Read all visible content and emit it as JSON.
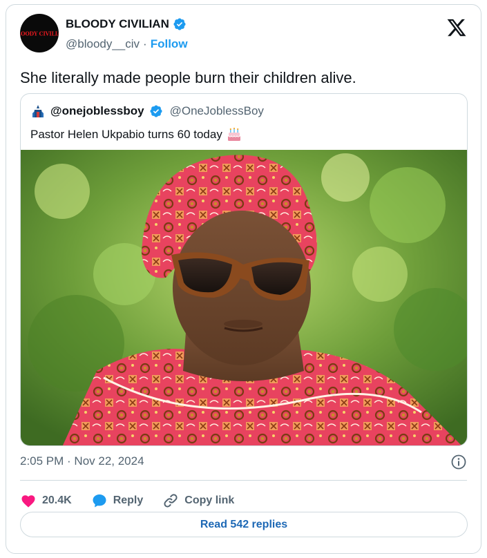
{
  "author": {
    "name": "BLOODY CIVILIAN",
    "handle": "@bloody__civ",
    "separator": "·",
    "follow_label": "Follow",
    "avatar_text": "BLOODY CIVILIAN"
  },
  "tweet": {
    "text": "She literally made people burn their children alive."
  },
  "quoted": {
    "name": "@onejoblessboy",
    "handle": "@OneJoblessBoy",
    "text": "Pastor Helen Ukpabio turns 60 today"
  },
  "meta": {
    "timestamp": "2:05 PM · Nov 22, 2024"
  },
  "actions": {
    "likes": "20.4K",
    "reply_label": "Reply",
    "copy_link_label": "Copy link"
  },
  "read_replies_label": "Read 542 replies",
  "colors": {
    "accent": "#1d9bf0",
    "like": "#f91880",
    "text": "#0f1419",
    "muted": "#536471",
    "border": "#cfd9de"
  },
  "icons": [
    "verified-badge-icon",
    "x-logo-icon",
    "birthday-cake-icon",
    "info-icon",
    "heart-icon",
    "reply-bubble-icon",
    "link-icon"
  ]
}
